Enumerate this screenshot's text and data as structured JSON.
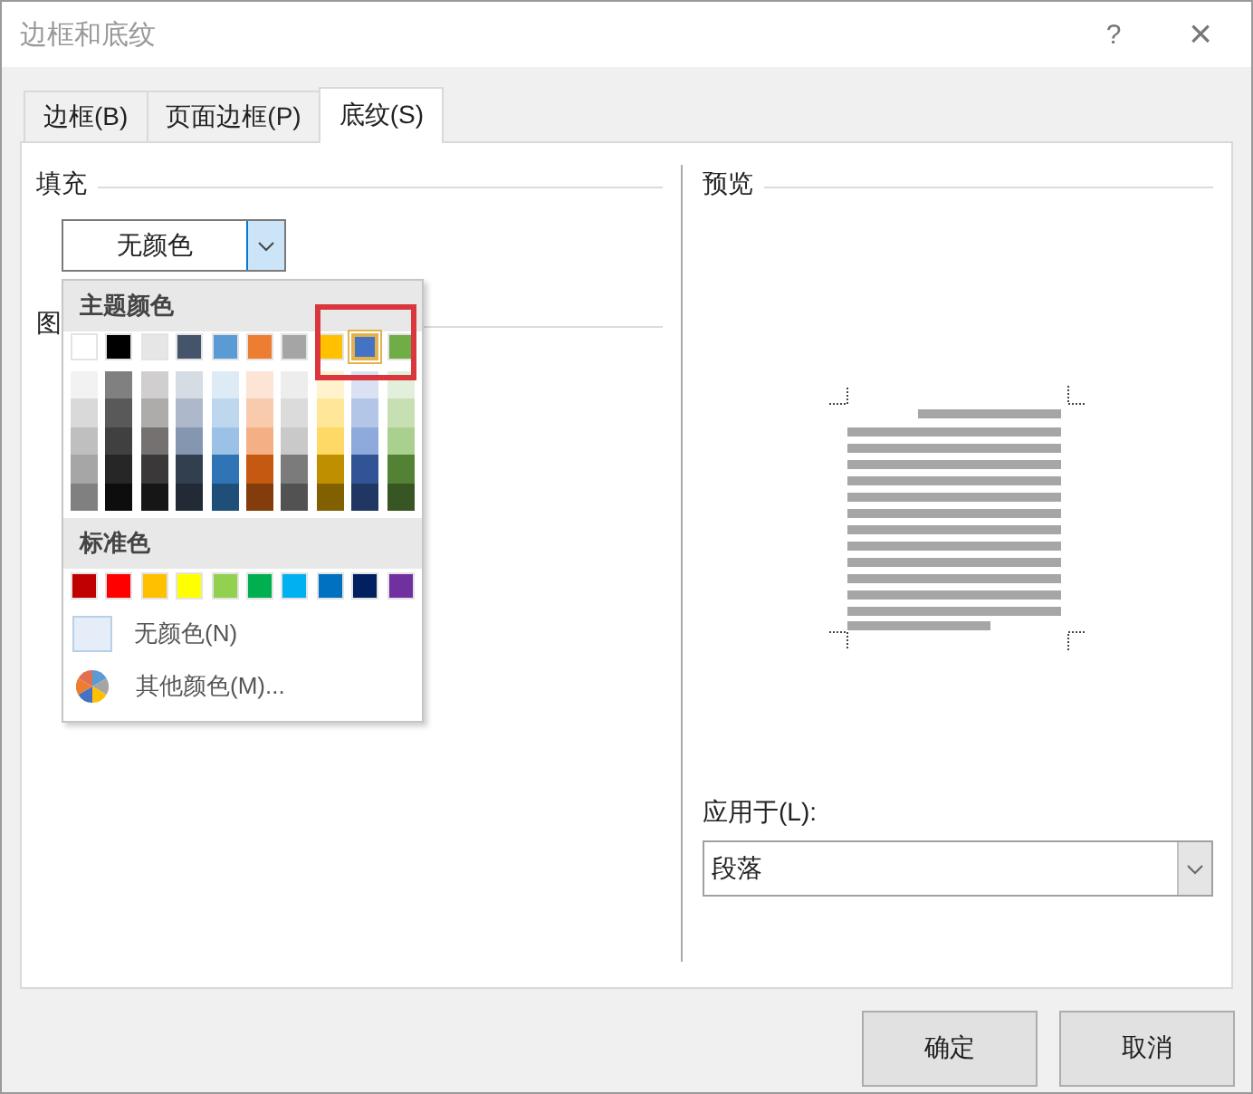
{
  "window": {
    "title": "边框和底纹",
    "help": "?",
    "close": "×"
  },
  "tabs": [
    {
      "label": "边框(B)",
      "selected": false
    },
    {
      "label": "页面边框(P)",
      "selected": false
    },
    {
      "label": "底纹(S)",
      "selected": true
    }
  ],
  "fill": {
    "heading": "填充",
    "value": "无颜色",
    "expanded": true
  },
  "pattern": {
    "heading": "图"
  },
  "color_menu": {
    "theme_heading": "主题颜色",
    "theme_colors": [
      {
        "color": "#ffffff",
        "selected": false,
        "shades": [
          {
            "color": "#f2f2f2"
          },
          {
            "color": "#d9d9d9"
          },
          {
            "color": "#bfbfbf"
          },
          {
            "color": "#a6a6a6"
          },
          {
            "color": "#808080"
          }
        ]
      },
      {
        "color": "#000000",
        "selected": false,
        "shades": [
          {
            "color": "#808080"
          },
          {
            "color": "#595959"
          },
          {
            "color": "#404040"
          },
          {
            "color": "#262626"
          },
          {
            "color": "#0d0d0d"
          }
        ]
      },
      {
        "color": "#e7e6e6",
        "selected": false,
        "shades": [
          {
            "color": "#d0cece"
          },
          {
            "color": "#aeabab"
          },
          {
            "color": "#757171"
          },
          {
            "color": "#3a3838"
          },
          {
            "color": "#161616"
          }
        ]
      },
      {
        "color": "#44546a",
        "selected": false,
        "shades": [
          {
            "color": "#d6dce4"
          },
          {
            "color": "#adb9ca"
          },
          {
            "color": "#8496b0"
          },
          {
            "color": "#323f4f"
          },
          {
            "color": "#222a35"
          }
        ]
      },
      {
        "color": "#5b9bd5",
        "selected": false,
        "shades": [
          {
            "color": "#ddebf7"
          },
          {
            "color": "#bdd7ee"
          },
          {
            "color": "#9bc2e6"
          },
          {
            "color": "#2f75b5"
          },
          {
            "color": "#1f4e78"
          }
        ]
      },
      {
        "color": "#ed7d31",
        "selected": false,
        "shades": [
          {
            "color": "#fce4d6"
          },
          {
            "color": "#f8cbad"
          },
          {
            "color": "#f4b084"
          },
          {
            "color": "#c65911"
          },
          {
            "color": "#833c0c"
          }
        ]
      },
      {
        "color": "#a5a5a5",
        "selected": false,
        "shades": [
          {
            "color": "#ededed"
          },
          {
            "color": "#dbdbdb"
          },
          {
            "color": "#c9c9c9"
          },
          {
            "color": "#7b7b7b"
          },
          {
            "color": "#525252"
          }
        ]
      },
      {
        "color": "#ffc000",
        "selected": false,
        "shades": [
          {
            "color": "#fff2cc"
          },
          {
            "color": "#ffe699"
          },
          {
            "color": "#ffd966"
          },
          {
            "color": "#bf8f00"
          },
          {
            "color": "#806000"
          }
        ]
      },
      {
        "color": "#4472c4",
        "selected": true,
        "shades": [
          {
            "color": "#d9e1f2"
          },
          {
            "color": "#b4c6e7"
          },
          {
            "color": "#8ea9db"
          },
          {
            "color": "#305496"
          },
          {
            "color": "#203764"
          }
        ]
      },
      {
        "color": "#70ad47",
        "selected": false,
        "shades": [
          {
            "color": "#e2efda"
          },
          {
            "color": "#c6e0b4"
          },
          {
            "color": "#a9d08e"
          },
          {
            "color": "#548235"
          },
          {
            "color": "#375623"
          }
        ]
      }
    ],
    "standard_heading": "标准色",
    "standard_colors": [
      {
        "color": "#c00000"
      },
      {
        "color": "#ff0000"
      },
      {
        "color": "#ffc000"
      },
      {
        "color": "#ffff00"
      },
      {
        "color": "#92d050"
      },
      {
        "color": "#00b050"
      },
      {
        "color": "#00b0f0"
      },
      {
        "color": "#0070c0"
      },
      {
        "color": "#002060"
      },
      {
        "color": "#7030a0"
      }
    ],
    "no_color": "无颜色(N)",
    "more_colors": "其他颜色(M)...",
    "highlight_box": true
  },
  "preview": {
    "heading": "预览"
  },
  "apply_to": {
    "label": "应用于(L):",
    "value": "段落"
  },
  "buttons": [
    {
      "label": "确定"
    },
    {
      "label": "取消"
    }
  ]
}
